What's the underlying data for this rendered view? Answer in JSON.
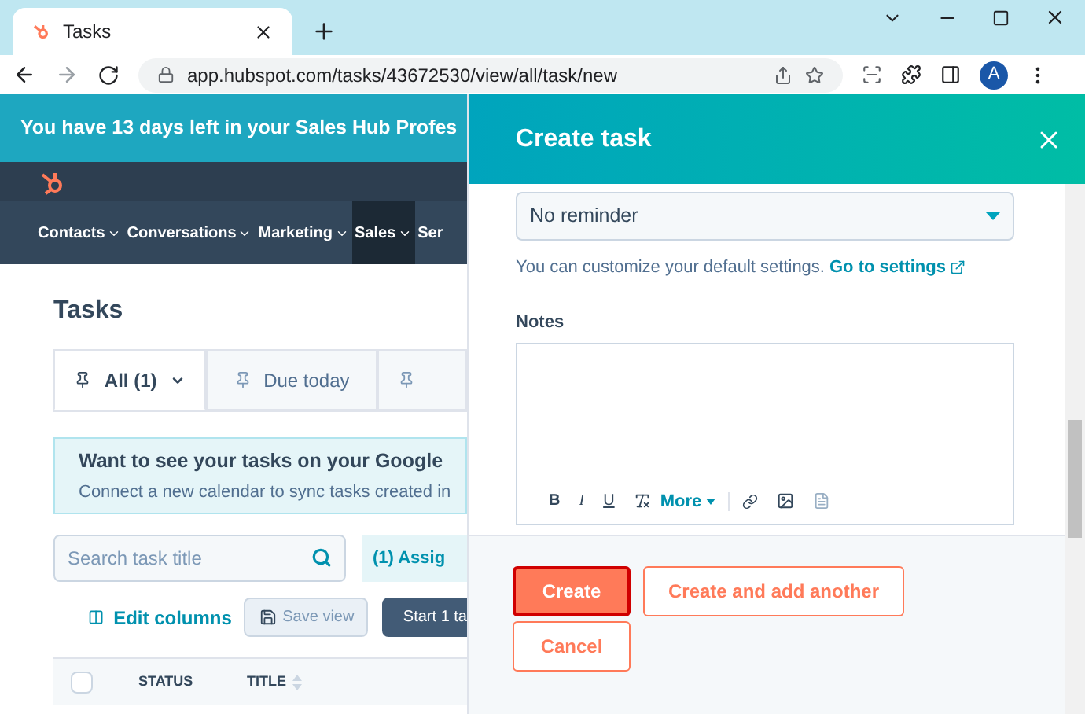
{
  "browser": {
    "tabs": [
      {
        "title": "Tasks",
        "selected": true
      }
    ],
    "url": "app.hubspot.com/tasks/43672530/view/all/task/new",
    "profile_initial": "A"
  },
  "trial_banner": "You have 13 days left in your Sales Hub Profes",
  "nav": [
    {
      "label": "Contacts",
      "selected": false
    },
    {
      "label": "Conversations",
      "selected": false
    },
    {
      "label": "Marketing",
      "selected": false
    },
    {
      "label": "Sales",
      "selected": true
    },
    {
      "label": "Ser",
      "selected": false
    }
  ],
  "heading": "Tasks",
  "view_tabs": [
    {
      "label": "All (1)",
      "selected": true
    },
    {
      "label": "Due today",
      "selected": false
    },
    {
      "selected": false
    }
  ],
  "calendar_card": {
    "title": "Want to see your tasks on your Google",
    "text": "Connect a new calendar to sync tasks created in"
  },
  "search": {
    "placeholder": "Search task title"
  },
  "filter_button": "(1) Assig",
  "edit_columns": "Edit columns",
  "save_view": {
    "label": "Save view",
    "disabled": true
  },
  "start_button": "Start 1 ta",
  "table": {
    "select_all_checked": false,
    "columns": [
      "STATUS",
      "TITLE"
    ]
  },
  "panel": {
    "title": "Create task",
    "reminder": "No reminder",
    "helper": "You can customize your default settings.",
    "settings_link": "Go to settings",
    "notes_label": "Notes",
    "format_buttons": [
      "B",
      "I",
      "U"
    ],
    "more": "More",
    "buttons": [
      {
        "label": "Create",
        "kind": "primary",
        "highlighted": true
      },
      {
        "label": "Create and add another",
        "kind": "secondary",
        "highlighted": false
      },
      {
        "label": "Cancel",
        "kind": "secondary",
        "highlighted": false
      }
    ]
  }
}
